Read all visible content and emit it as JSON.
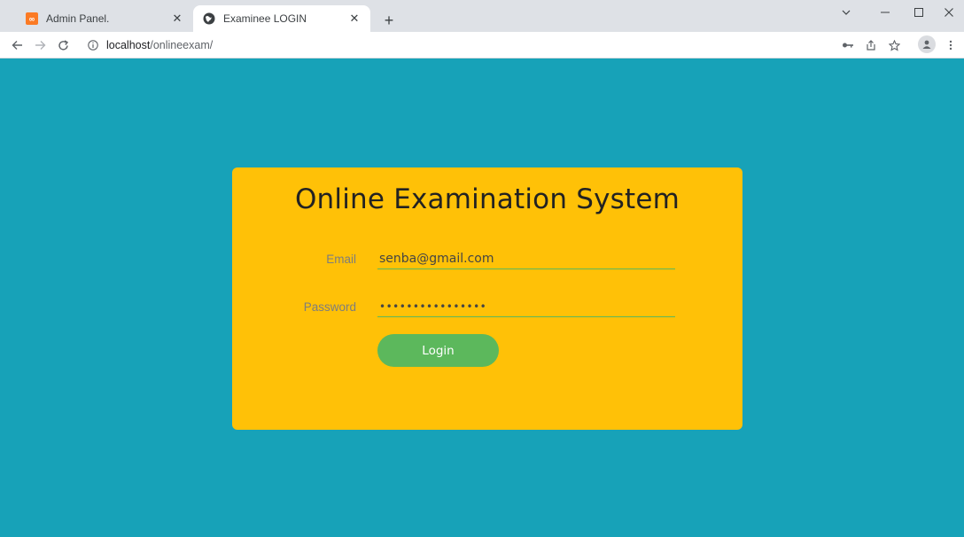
{
  "browser": {
    "tabs": [
      {
        "title": "Admin Panel.",
        "favicon": "xampp-icon",
        "active": false
      },
      {
        "title": "Examinee LOGIN",
        "favicon": "globe-icon",
        "active": true
      }
    ],
    "new_tab_symbol": "+",
    "url": {
      "host": "localhost",
      "path": "/onlineexam/"
    }
  },
  "login_form": {
    "title": "Online Examination System",
    "email_label": "Email",
    "email_value": "senba@gmail.com",
    "password_label": "Password",
    "password_value": "••••••••••••••••",
    "submit_label": "Login"
  },
  "colors": {
    "page_background": "#17a2b8",
    "card_background": "#ffc107",
    "accent_green": "#5cb85c"
  }
}
